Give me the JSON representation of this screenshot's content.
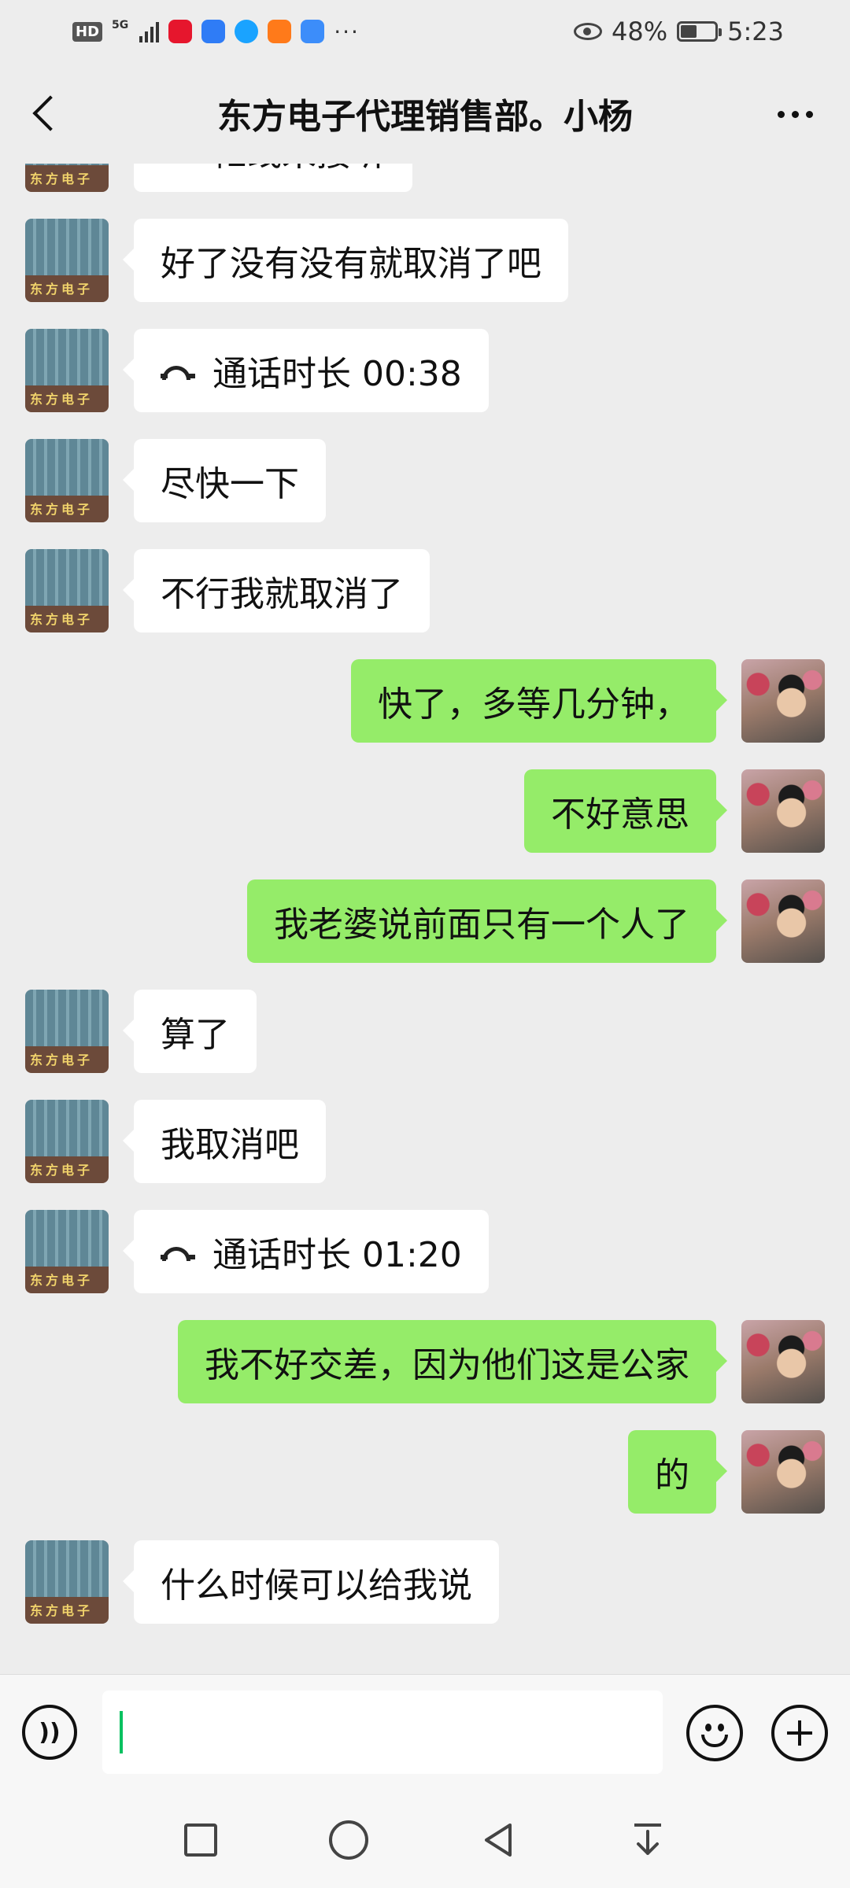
{
  "status_bar": {
    "network_badge": "HD",
    "network_type": "5G",
    "more_indicator": "···",
    "battery_text": "48%",
    "battery_level": 0.48,
    "time": "5:23"
  },
  "header": {
    "title": "东方电子代理销售部。小杨"
  },
  "messages": [
    {
      "side": "in",
      "type": "call",
      "text": "忙线未接听"
    },
    {
      "side": "in",
      "type": "text",
      "text": "好了没有没有就取消了吧"
    },
    {
      "side": "in",
      "type": "call",
      "text": "通话时长 00:38"
    },
    {
      "side": "in",
      "type": "text",
      "text": "尽快一下"
    },
    {
      "side": "in",
      "type": "text",
      "text": "不行我就取消了"
    },
    {
      "side": "out",
      "type": "text",
      "text": "快了，多等几分钟，"
    },
    {
      "side": "out",
      "type": "text",
      "text": "不好意思"
    },
    {
      "side": "out",
      "type": "text",
      "text": "我老婆说前面只有一个人了"
    },
    {
      "side": "in",
      "type": "text",
      "text": "算了"
    },
    {
      "side": "in",
      "type": "text",
      "text": "我取消吧"
    },
    {
      "side": "in",
      "type": "call",
      "text": "通话时长 01:20"
    },
    {
      "side": "out",
      "type": "text",
      "text": "我不好交差，因为他们这是公家"
    },
    {
      "side": "out",
      "type": "text",
      "text": "的"
    },
    {
      "side": "in",
      "type": "text",
      "text": "什么时候可以给我说"
    }
  ],
  "contact_avatar_sign": "东方电子",
  "input": {
    "value": ""
  },
  "colors": {
    "background": "#ededed",
    "outgoing_bubble": "#95ec69",
    "incoming_bubble": "#ffffff",
    "caret": "#07c160"
  }
}
